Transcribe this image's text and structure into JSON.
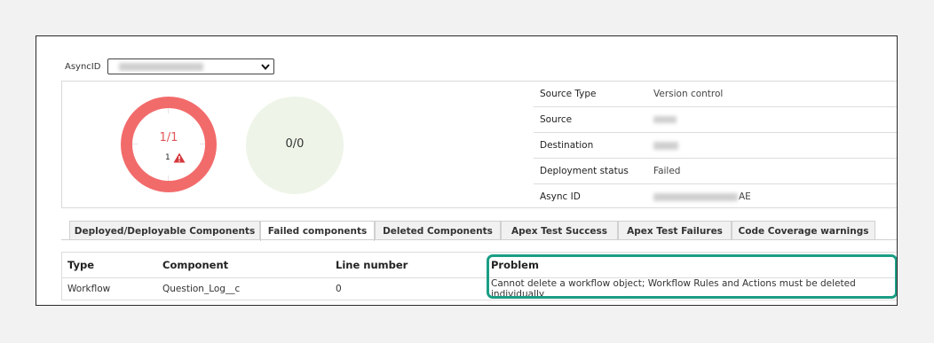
{
  "asyncid": {
    "label": "AsyncID",
    "selected_value": ""
  },
  "summary": {
    "components_ratio": "1/1",
    "failed_count": "1",
    "tests_ratio": "0/0"
  },
  "info": {
    "rows": [
      {
        "label": "Source Type",
        "value": "Version control"
      },
      {
        "label": "Source",
        "value": ""
      },
      {
        "label": "Destination",
        "value": ""
      },
      {
        "label": "Deployment status",
        "value": "Failed"
      },
      {
        "label": "Async ID",
        "value": "AE"
      }
    ]
  },
  "tabs": [
    {
      "label": "Deployed/Deployable Components",
      "active": false
    },
    {
      "label": "Failed components",
      "active": true
    },
    {
      "label": "Deleted Components",
      "active": false
    },
    {
      "label": "Apex Test Success",
      "active": false
    },
    {
      "label": "Apex Test Failures",
      "active": false
    },
    {
      "label": "Code Coverage warnings",
      "active": false
    }
  ],
  "table": {
    "headers": [
      "Type",
      "Component",
      "Line number",
      "Problem"
    ],
    "rows": [
      [
        "Workflow",
        "Question_Log__c",
        "0",
        "Cannot delete a workflow object; Workflow Rules and Actions must be deleted individually"
      ]
    ]
  },
  "colors": {
    "error": "#f26b6b",
    "highlight": "#1a9e84",
    "success_bg": "#eef5e8"
  },
  "icons": {
    "warning": "warning-triangle-icon",
    "select": "chevron-down-icon"
  }
}
